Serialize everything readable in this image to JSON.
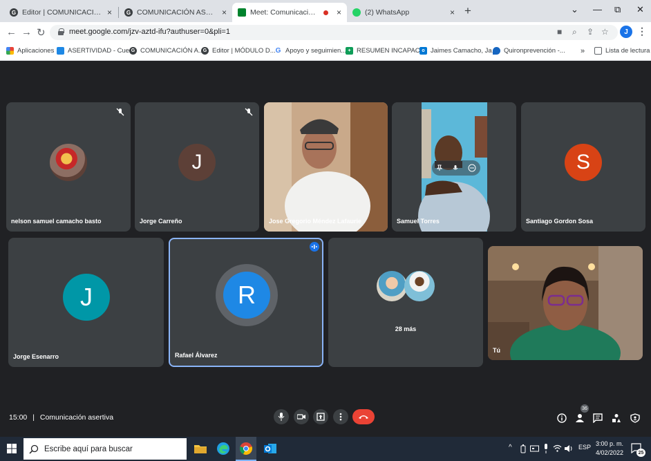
{
  "browser": {
    "tabs": [
      {
        "title": "Editor | COMUNICACIÓN ASERTIVA",
        "close": "×"
      },
      {
        "title": "COMUNICACIÓN ASERTIVA por |",
        "close": "×"
      },
      {
        "title": "Meet: Comunicación asertiva",
        "close": "×"
      },
      {
        "title": "(2) WhatsApp",
        "close": "×"
      }
    ],
    "new_tab": "+",
    "url": "meet.google.com/jzv-aztd-ifu?authuser=0&pli=1",
    "profile_initial": "J",
    "bookmarks": [
      "Aplicaciones",
      "ASERTIVIDAD - Cue...",
      "COMUNICACIÓN A...",
      "Editor | MÓDULO D...",
      "Apoyo y seguimien...",
      "RESUMEN INCAPAC...",
      "Jaimes Camacho, Ja...",
      "Quironprevención -..."
    ],
    "bookmarks_more": "»",
    "reading_list": "Lista de lectura"
  },
  "meet": {
    "participants": [
      {
        "name": "nelson samuel camacho basto"
      },
      {
        "name": "Jorge Carreño",
        "initial": "J"
      },
      {
        "name": "Jose Gregorio Méndez Lafaurie"
      },
      {
        "name": "Samuel Torres"
      },
      {
        "name": "Santiago Gordon Sosa",
        "initial": "S"
      },
      {
        "name": "Jorge Esenarro",
        "initial": "J"
      },
      {
        "name": "Rafael Álvarez",
        "initial": "R"
      },
      {
        "name": "28 más"
      },
      {
        "name": "Tú"
      }
    ],
    "time": "15:00",
    "separator": "|",
    "meeting_name": "Comunicación asertiva",
    "people_count": "36"
  },
  "taskbar": {
    "search_placeholder": "Escribe aquí para buscar",
    "language": "ESP",
    "time": "3:00 p. m.",
    "date": "4/02/2022",
    "notifications": "25"
  },
  "colors": {
    "meet_bg": "#202124",
    "tile_bg": "#3c4043",
    "jorge_carreno_avatar": "#5d4037",
    "santiago_avatar": "#d84315",
    "jorge_esenarro_avatar": "#0097a7",
    "rafael_avatar": "#1e88e5",
    "end_call": "#ea4335"
  }
}
